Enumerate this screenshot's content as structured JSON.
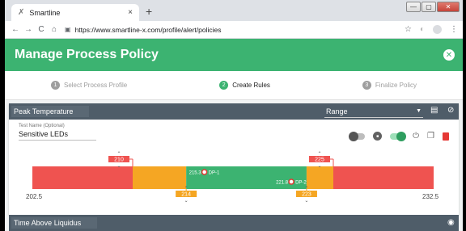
{
  "browser": {
    "tab_title": "Smartline",
    "tab_close": "×",
    "new_tab": "+",
    "url": "https://www.smartline-x.com/profile/alert/policies",
    "win_min": "—",
    "win_max": "▢",
    "win_close": "✕"
  },
  "app": {
    "title": "Manage Process Policy",
    "close_glyph": "✕"
  },
  "stepper": [
    {
      "num": "1",
      "label": "Select Process Profile",
      "active": false
    },
    {
      "num": "2",
      "label": "Create Rules",
      "active": true
    },
    {
      "num": "3",
      "label": "Finalize Policy",
      "active": false
    }
  ],
  "panel": {
    "title": "Peak Temperature",
    "select_value": "Range",
    "test_name_label": "Test Name (Optional)",
    "test_name_value": "Sensitive LEDs"
  },
  "chart_data": {
    "type": "range-bar",
    "min_label": "202.5",
    "max_label": "232.5",
    "min": 202.5,
    "max": 232.5,
    "lower_red_limit": 210,
    "lower_orange_limit": 214,
    "upper_orange_limit": 223,
    "upper_red_limit": 225,
    "data_points": [
      {
        "label": "DP-1",
        "value": 215.3,
        "text": "215.3"
      },
      {
        "label": "DP-2",
        "value": 221.8,
        "text": "221.8"
      }
    ],
    "colors": {
      "red": "#ef5350",
      "orange": "#f5a623",
      "green": "#3cb371"
    }
  },
  "next_panel": {
    "title": "Time Above Liquidus"
  },
  "icons": {
    "back": "←",
    "forward": "→",
    "reload": "C",
    "home": "⌂",
    "lock": "🔒",
    "star": "☆",
    "menu": "⋮",
    "eye": "◉",
    "save": "▮"
  }
}
